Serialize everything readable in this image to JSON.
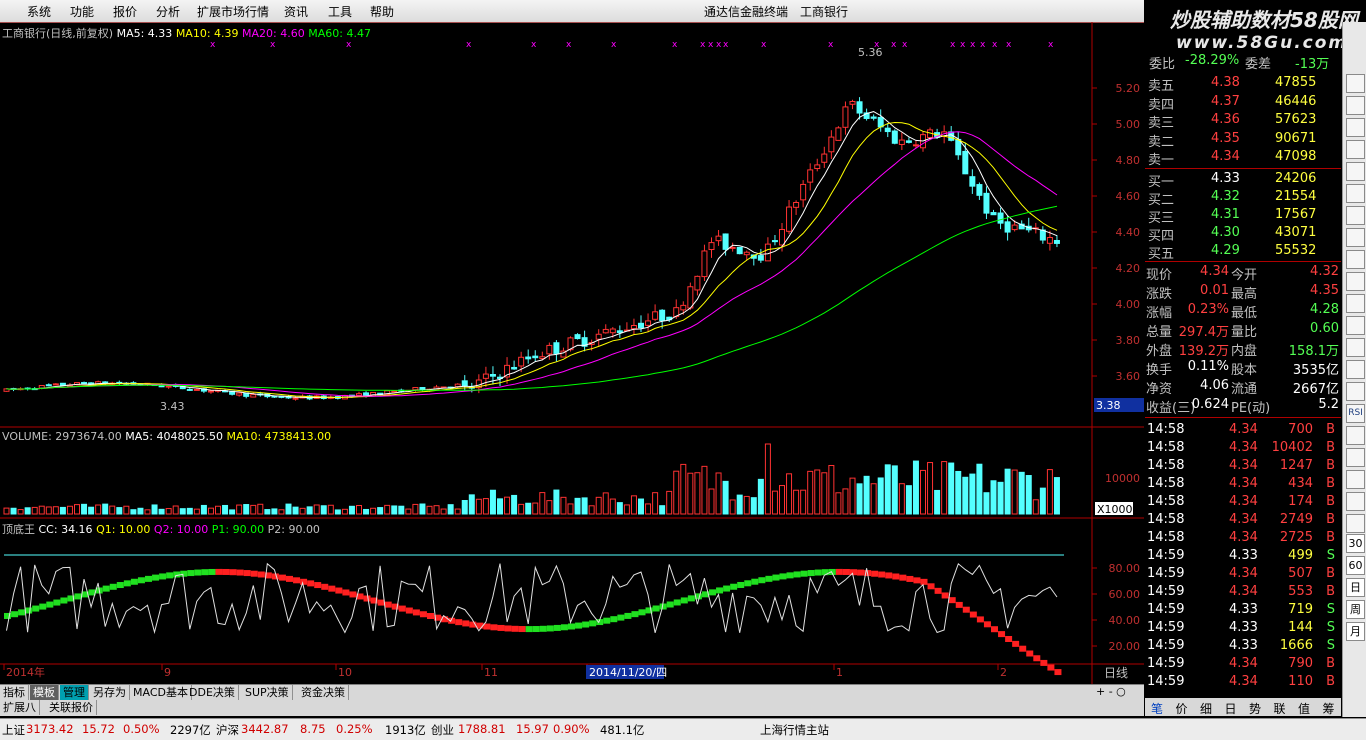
{
  "menu": {
    "items": [
      "系统",
      "功能",
      "报价",
      "分析",
      "扩展市场行情",
      "资讯",
      "工具",
      "帮助"
    ],
    "app_title": "通达信金融终端",
    "stock_title": "工商银行",
    "watermark_line1": "炒股辅助数材58股网",
    "watermark_line2": "www.58Gu.com"
  },
  "main_chart": {
    "legend_name": "工商银行(日线,前复权)",
    "ma5": "MA5: 4.33",
    "ma10": "MA10: 4.39",
    "ma20": "MA20: 4.60",
    "ma60": "MA60: 4.47",
    "price_ticks": [
      "5.20",
      "5.00",
      "4.80",
      "4.60",
      "4.40",
      "4.20",
      "4.00",
      "3.80",
      "3.60"
    ],
    "current_price_label": "3.38",
    "high_label": "5.36",
    "low_label": "3.43"
  },
  "volume_chart": {
    "legend": "VOLUME: 2973674.00",
    "ma5": "MA5: 4048025.50",
    "ma10": "MA10: 4738413.00",
    "tick_10000": "10000",
    "unit": "X1000"
  },
  "indicator": {
    "legend_name": "顶底王",
    "cc": "CC: 34.16",
    "q1": "Q1: 10.00",
    "q2": "Q2: 10.00",
    "p1": "P1: 90.00",
    "p2": "P2: 90.00",
    "ticks": [
      "80.00",
      "60.00",
      "40.00",
      "20.00"
    ]
  },
  "time_axis": {
    "labels": [
      "2014年",
      "9",
      "10",
      "11",
      "2014/11/20/四",
      "1",
      "2"
    ],
    "period": "日线"
  },
  "tabs": [
    "指标",
    "模板",
    "管理",
    "另存为",
    "MACD基本",
    "DDE决策",
    "SUP决策",
    "资金决策"
  ],
  "tabs2": [
    "扩展八",
    "关联报价"
  ],
  "quote": {
    "header": [
      {
        "label": "委比",
        "value": "-28.29%"
      },
      {
        "label": "委差",
        "value": "-13万"
      }
    ],
    "sell": [
      {
        "label": "卖五",
        "price": "4.38",
        "vol": "47855"
      },
      {
        "label": "卖四",
        "price": "4.37",
        "vol": "46446"
      },
      {
        "label": "卖三",
        "price": "4.36",
        "vol": "57623"
      },
      {
        "label": "卖二",
        "price": "4.35",
        "vol": "90671"
      },
      {
        "label": "卖一",
        "price": "4.34",
        "vol": "47098"
      }
    ],
    "buy": [
      {
        "label": "买一",
        "price": "4.33",
        "vol": "24206"
      },
      {
        "label": "买二",
        "price": "4.32",
        "vol": "21554"
      },
      {
        "label": "买三",
        "price": "4.31",
        "vol": "17567"
      },
      {
        "label": "买四",
        "price": "4.30",
        "vol": "43071"
      },
      {
        "label": "买五",
        "price": "4.29",
        "vol": "55532"
      }
    ],
    "stats": [
      {
        "l1": "现价",
        "v1": "4.34",
        "l2": "今开",
        "v2": "4.32"
      },
      {
        "l1": "涨跌",
        "v1": "0.01",
        "l2": "最高",
        "v2": "4.35"
      },
      {
        "l1": "涨幅",
        "v1": "0.23%",
        "l2": "最低",
        "v2": "4.28"
      },
      {
        "l1": "总量",
        "v1": "297.4万",
        "l2": "量比",
        "v2": "0.60"
      },
      {
        "l1": "外盘",
        "v1": "139.2万",
        "l2": "内盘",
        "v2": "158.1万"
      },
      {
        "l1": "换手",
        "v1": "0.11%",
        "l2": "股本",
        "v2": "3535亿"
      },
      {
        "l1": "净资",
        "v1": "4.06",
        "l2": "流通",
        "v2": "2667亿"
      },
      {
        "l1": "收益(三)",
        "v1": "0.624",
        "l2": "PE(动)",
        "v2": "5.2"
      }
    ],
    "ticks": [
      {
        "t": "14:58",
        "p": "4.34",
        "v": "700",
        "d": "B"
      },
      {
        "t": "14:58",
        "p": "4.34",
        "v": "10402",
        "d": "B"
      },
      {
        "t": "14:58",
        "p": "4.34",
        "v": "1247",
        "d": "B"
      },
      {
        "t": "14:58",
        "p": "4.34",
        "v": "434",
        "d": "B"
      },
      {
        "t": "14:58",
        "p": "4.34",
        "v": "174",
        "d": "B"
      },
      {
        "t": "14:58",
        "p": "4.34",
        "v": "2749",
        "d": "B"
      },
      {
        "t": "14:58",
        "p": "4.34",
        "v": "2725",
        "d": "B"
      },
      {
        "t": "14:59",
        "p": "4.33",
        "v": "499",
        "d": "S"
      },
      {
        "t": "14:59",
        "p": "4.34",
        "v": "507",
        "d": "B"
      },
      {
        "t": "14:59",
        "p": "4.34",
        "v": "553",
        "d": "B"
      },
      {
        "t": "14:59",
        "p": "4.33",
        "v": "719",
        "d": "S"
      },
      {
        "t": "14:59",
        "p": "4.33",
        "v": "144",
        "d": "S"
      },
      {
        "t": "14:59",
        "p": "4.33",
        "v": "1666",
        "d": "S"
      },
      {
        "t": "14:59",
        "p": "4.34",
        "v": "790",
        "d": "B"
      },
      {
        "t": "14:59",
        "p": "4.34",
        "v": "110",
        "d": "B"
      }
    ],
    "bottom_tabs": [
      "笔",
      "价",
      "细",
      "日",
      "势",
      "联",
      "值",
      "筹"
    ]
  },
  "side_buttons": [
    "RSI",
    "30",
    "60",
    "日",
    "周",
    "月"
  ],
  "status": {
    "sh_label": "上证",
    "sh_val": "3173.42",
    "sh_chg": "15.72",
    "sh_pct": "0.50%",
    "sh_amt": "2297亿",
    "hs_label": "沪深",
    "hs_val": "3442.87",
    "hs_chg": "8.75",
    "hs_pct": "0.25%",
    "hs_amt": "1913亿",
    "cy_label": "创业",
    "cy_val": "1788.81",
    "cy_chg": "15.97",
    "cy_pct": "0.90%",
    "cy_amt": "481.1亿",
    "server": "上海行情主站"
  },
  "colors": {
    "up": "#ff3232",
    "down": "#54ffff",
    "ma5": "#ffffff",
    "ma10": "#ffff00",
    "ma20": "#ff00ff",
    "ma60": "#00ff00",
    "axis": "#b00000"
  }
}
